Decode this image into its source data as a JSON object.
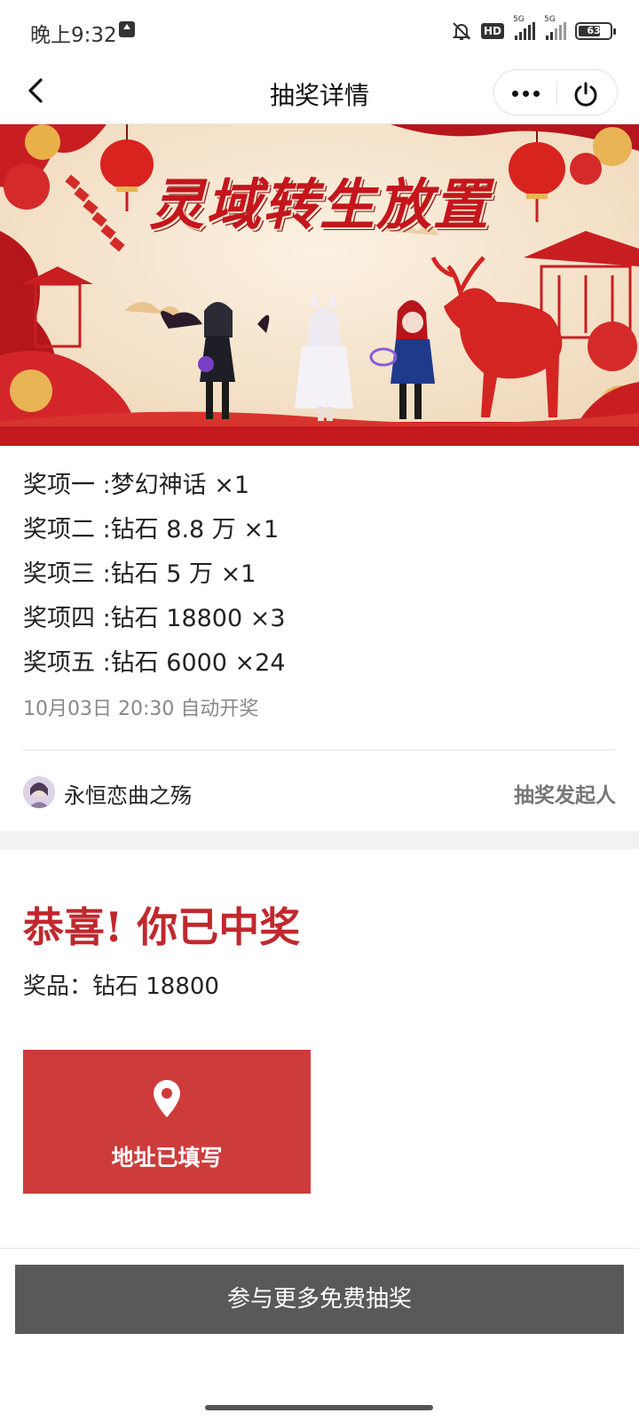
{
  "status_bar": {
    "time": "晚上9:32",
    "hd_label": "HD",
    "network_1": "5G",
    "network_2": "5G",
    "battery": "63",
    "icons": [
      "upload-icon",
      "mute-bell-icon",
      "hd-icon",
      "signal-icon",
      "signal-icon",
      "battery-icon"
    ]
  },
  "nav": {
    "title": "抽奖详情",
    "back_icon": "chevron-left-icon",
    "more_icon": "more-dots-icon",
    "close_icon": "power-icon"
  },
  "banner": {
    "title": "灵域转生放置",
    "colors": {
      "red": "#c4161c",
      "cream": "#f6e7d1"
    }
  },
  "prizes": [
    {
      "text": "奖项一 :梦幻神话 ×1"
    },
    {
      "text": "奖项二 :钻石 8.8 万 ×1"
    },
    {
      "text": "奖项三 :钻石 5 万 ×1"
    },
    {
      "text": "奖项四 :钻石 18800 ×3"
    },
    {
      "text": "奖项五 :钻石 6000 ×24"
    }
  ],
  "draw_time": "10月03日 20:30 自动开奖",
  "organizer": {
    "name": "永恒恋曲之殇",
    "role": "抽奖发起人"
  },
  "result": {
    "congrats": "恭喜! 你已中奖",
    "prize": "奖品：钻石 18800",
    "address_button": "地址已填写",
    "address_icon": "location-pin-icon",
    "accent_color": "#cd3c3b"
  },
  "more_button": "参与更多免费抽奖"
}
